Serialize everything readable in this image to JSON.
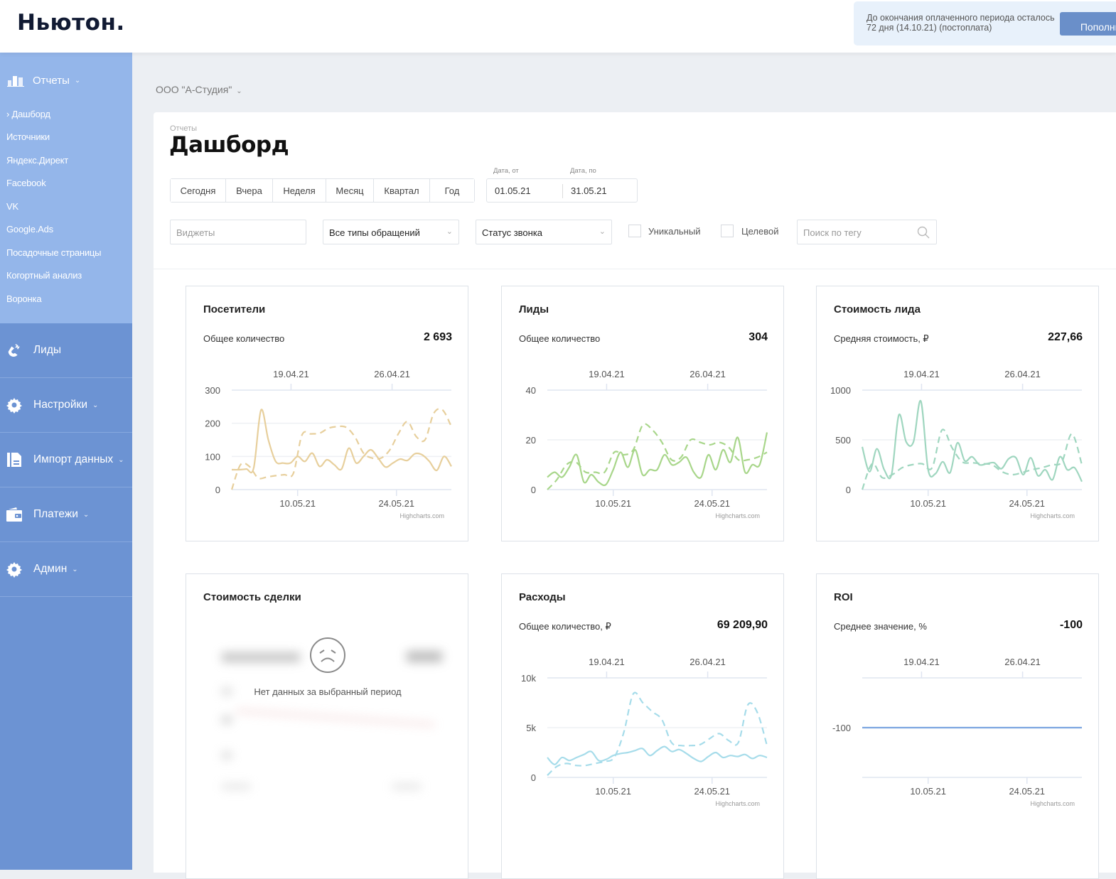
{
  "header": {
    "logo": "Ньютон.",
    "notice_text": "До окончания оплаченного периода осталось 72 дня (14.10.21) (постоплата)",
    "topup_button": "Пополнить"
  },
  "sidebar": {
    "reports_label": "Отчеты",
    "report_items": [
      {
        "label": "› Дашборд",
        "active": true
      },
      {
        "label": "Источники"
      },
      {
        "label": "Яндекс.Директ"
      },
      {
        "label": "Facebook"
      },
      {
        "label": "VK"
      },
      {
        "label": "Google.Ads"
      },
      {
        "label": "Посадочные страницы"
      },
      {
        "label": "Когортный анализ"
      },
      {
        "label": "Воронка"
      }
    ],
    "menu": [
      {
        "label": "Лиды",
        "icon": "magnet-icon",
        "chevron": false
      },
      {
        "label": "Настройки",
        "icon": "gear-icon",
        "chevron": true
      },
      {
        "label": "Импорт данных",
        "icon": "document-icon",
        "chevron": true
      },
      {
        "label": "Платежи",
        "icon": "wallet-icon",
        "chevron": true
      },
      {
        "label": "Админ",
        "icon": "gear-icon",
        "chevron": true
      }
    ]
  },
  "company": "ООО \"А-Студия\"",
  "page": {
    "breadcrumb": "Отчеты",
    "title": "Дашборд",
    "periods": [
      "Сегодня",
      "Вчера",
      "Неделя",
      "Месяц",
      "Квартал",
      "Год"
    ],
    "date_from_label": "Дата, от",
    "date_to_label": "Дата, по",
    "date_from": "01.05.21",
    "date_to": "31.05.21",
    "filters": {
      "widgets_placeholder": "Виджеты",
      "request_types": "Все типы обращений",
      "call_status": "Статус звонка",
      "unique_label": "Уникальный",
      "unique_checked": false,
      "target_label": "Целевой",
      "target_checked": false,
      "tag_search_placeholder": "Поиск по тегу"
    }
  },
  "chart_data": [
    {
      "type": "line",
      "title": "Посетители",
      "metric_label": "Общее количество",
      "metric_value": "2 693",
      "color": "#e7cf9c",
      "ylim": [
        0,
        300
      ],
      "yticks": [
        "0",
        "100",
        "200",
        "300"
      ],
      "x_bottom_ticks": [
        "10.05.21",
        "24.05.21"
      ],
      "x_top_ticks": [
        "19.04.21",
        "26.04.21"
      ],
      "credit": "Highcharts.com",
      "series": [
        {
          "name": "current",
          "style": "solid",
          "values": [
            60,
            60,
            62,
            65,
            240,
            150,
            85,
            80,
            80,
            100,
            85,
            110,
            70,
            90,
            75,
            62,
            125,
            80,
            100,
            120,
            95,
            68,
            80,
            92,
            88,
            108,
            105,
            85,
            58,
            100,
            70
          ]
        },
        {
          "name": "previous",
          "style": "dashed",
          "values": [
            0,
            75,
            70,
            35,
            38,
            42,
            45,
            48,
            165,
            168,
            170,
            185,
            190,
            188,
            160,
            110,
            95,
            95,
            120,
            170,
            205,
            160,
            150,
            230,
            240,
            190
          ]
        }
      ]
    },
    {
      "type": "line",
      "title": "Лиды",
      "metric_label": "Общее количество",
      "metric_value": "304",
      "color": "#a8d68a",
      "ylim": [
        0,
        40
      ],
      "yticks": [
        "0",
        "20",
        "40"
      ],
      "x_bottom_ticks": [
        "10.05.21",
        "24.05.21"
      ],
      "x_top_ticks": [
        "19.04.21",
        "26.04.21"
      ],
      "credit": "Highcharts.com",
      "series": [
        {
          "name": "current",
          "style": "solid",
          "values": [
            5,
            7,
            5,
            9,
            14,
            3,
            6,
            3,
            2,
            8,
            15,
            9,
            16,
            6,
            8,
            8,
            14,
            10,
            11,
            13,
            7,
            5,
            14,
            8,
            16,
            11,
            21,
            7,
            10,
            10,
            23
          ]
        },
        {
          "name": "previous",
          "style": "dashed",
          "values": [
            0,
            4,
            10,
            11,
            7,
            7,
            7,
            15,
            14,
            16,
            26,
            24,
            19,
            12,
            13,
            20,
            19,
            18,
            19,
            17,
            12,
            12,
            13,
            15
          ]
        }
      ]
    },
    {
      "type": "line",
      "title": "Стоимость лида",
      "metric_label": "Средняя стоимость, ₽",
      "metric_value": "227,66",
      "color": "#9fd6bf",
      "ylim": [
        0,
        1000
      ],
      "yticks": [
        "0",
        "500",
        "1000"
      ],
      "x_bottom_ticks": [
        "10.05.21",
        "24.05.21"
      ],
      "x_top_ticks": [
        "19.04.21",
        "26.04.21"
      ],
      "credit": "Highcharts.com",
      "series": [
        {
          "name": "current",
          "style": "solid",
          "values": [
            430,
            180,
            410,
            200,
            150,
            750,
            480,
            480,
            890,
            200,
            160,
            280,
            170,
            470,
            290,
            330,
            250,
            260,
            270,
            210,
            310,
            320,
            150,
            320,
            140,
            200,
            100,
            330,
            200,
            220,
            80
          ]
        },
        {
          "name": "previous",
          "style": "dashed",
          "values": [
            0,
            260,
            120,
            150,
            220,
            250,
            260,
            220,
            600,
            420,
            280,
            270,
            260,
            250,
            180,
            150,
            170,
            200,
            220,
            250,
            280,
            560,
            250
          ]
        }
      ]
    },
    {
      "type": "empty",
      "title": "Стоимость сделки",
      "empty_text": "Нет данных за выбранный период",
      "empty_icon": "sad-face-icon"
    },
    {
      "type": "line",
      "title": "Расходы",
      "metric_label": "Общее количество, ₽",
      "metric_value": "69 209,90",
      "color": "#a6dcea",
      "ylim": [
        0,
        10000
      ],
      "yticks": [
        "0",
        "5k",
        "10k"
      ],
      "x_bottom_ticks": [
        "10.05.21",
        "24.05.21"
      ],
      "x_top_ticks": [
        "19.04.21",
        "26.04.21"
      ],
      "credit": "Highcharts.com",
      "series": [
        {
          "name": "current",
          "style": "solid",
          "values": [
            2000,
            1300,
            2000,
            1700,
            2000,
            2300,
            2600,
            1700,
            1800,
            2200,
            2400,
            2500,
            2700,
            2900,
            2200,
            2700,
            3100,
            2600,
            2800,
            2400,
            1900,
            1600,
            2100,
            2500,
            2000,
            2200,
            2100,
            2300,
            1900,
            2200,
            2000
          ]
        },
        {
          "name": "previous",
          "style": "dashed",
          "values": [
            200,
            1100,
            1400,
            1200,
            1200,
            1400,
            1600,
            2000,
            4500,
            8400,
            7500,
            6600,
            5800,
            3500,
            3200,
            3200,
            3300,
            3900,
            4400,
            3700,
            3500,
            7300,
            6500,
            3200
          ]
        }
      ]
    },
    {
      "type": "line",
      "title": "ROI",
      "metric_label": "Среднее значение, %",
      "metric_value": "-100",
      "color": "#7ca6e0",
      "ylim": [
        -200,
        0
      ],
      "yticks": [
        "-100"
      ],
      "x_bottom_ticks": [
        "10.05.21",
        "24.05.21"
      ],
      "x_top_ticks": [
        "19.04.21",
        "26.04.21"
      ],
      "credit": "Highcharts.com",
      "series": [
        {
          "name": "current",
          "style": "solid",
          "values": [
            -100,
            -100,
            -100,
            -100,
            -100,
            -100,
            -100,
            -100,
            -100,
            -100,
            -100,
            -100,
            -100,
            -100,
            -100,
            -100,
            -100,
            -100,
            -100,
            -100,
            -100,
            -100,
            -100,
            -100,
            -100,
            -100,
            -100,
            -100,
            -100,
            -100,
            -100
          ]
        }
      ]
    }
  ]
}
